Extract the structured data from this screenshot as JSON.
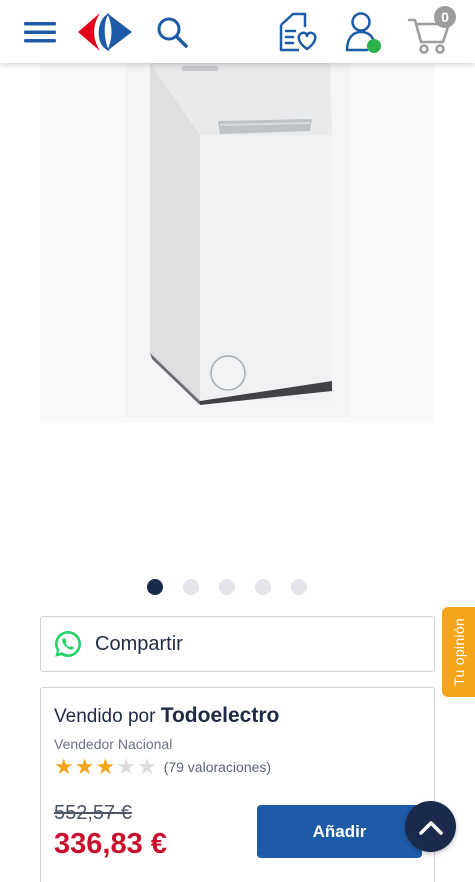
{
  "header": {
    "menu_icon": "hamburger-menu-icon",
    "logo": "carrefour-logo",
    "search_icon": "search-icon",
    "list_icon": "favorites-list-icon",
    "account_icon": "user-account-icon",
    "cart_icon": "shopping-cart-icon",
    "cart_count": "0"
  },
  "gallery": {
    "image": "washing-machine-product-image",
    "total_images": 5,
    "active_index": 0
  },
  "share": {
    "label": "Compartir",
    "icon": "whatsapp-icon"
  },
  "feedback": {
    "label": "Tu opinión"
  },
  "seller": {
    "prefix": "Vendido por",
    "name": "Todoelectro",
    "type": "Vendedor Nacional",
    "rating": 3,
    "rating_max": 5,
    "reviews": "(79 valoraciones)"
  },
  "price": {
    "old": "552,57 €",
    "current": "336,83 €"
  },
  "actions": {
    "add_label": "Añadir",
    "scroll_top_icon": "chevron-up-icon"
  },
  "colors": {
    "navy": "#1b2a4a",
    "brand_blue": "#1d5ba8",
    "brand_red": "#e2001a",
    "price_red": "#c8102e",
    "star": "#f4a51c",
    "whatsapp": "#25d366",
    "online": "#2bb24c"
  }
}
